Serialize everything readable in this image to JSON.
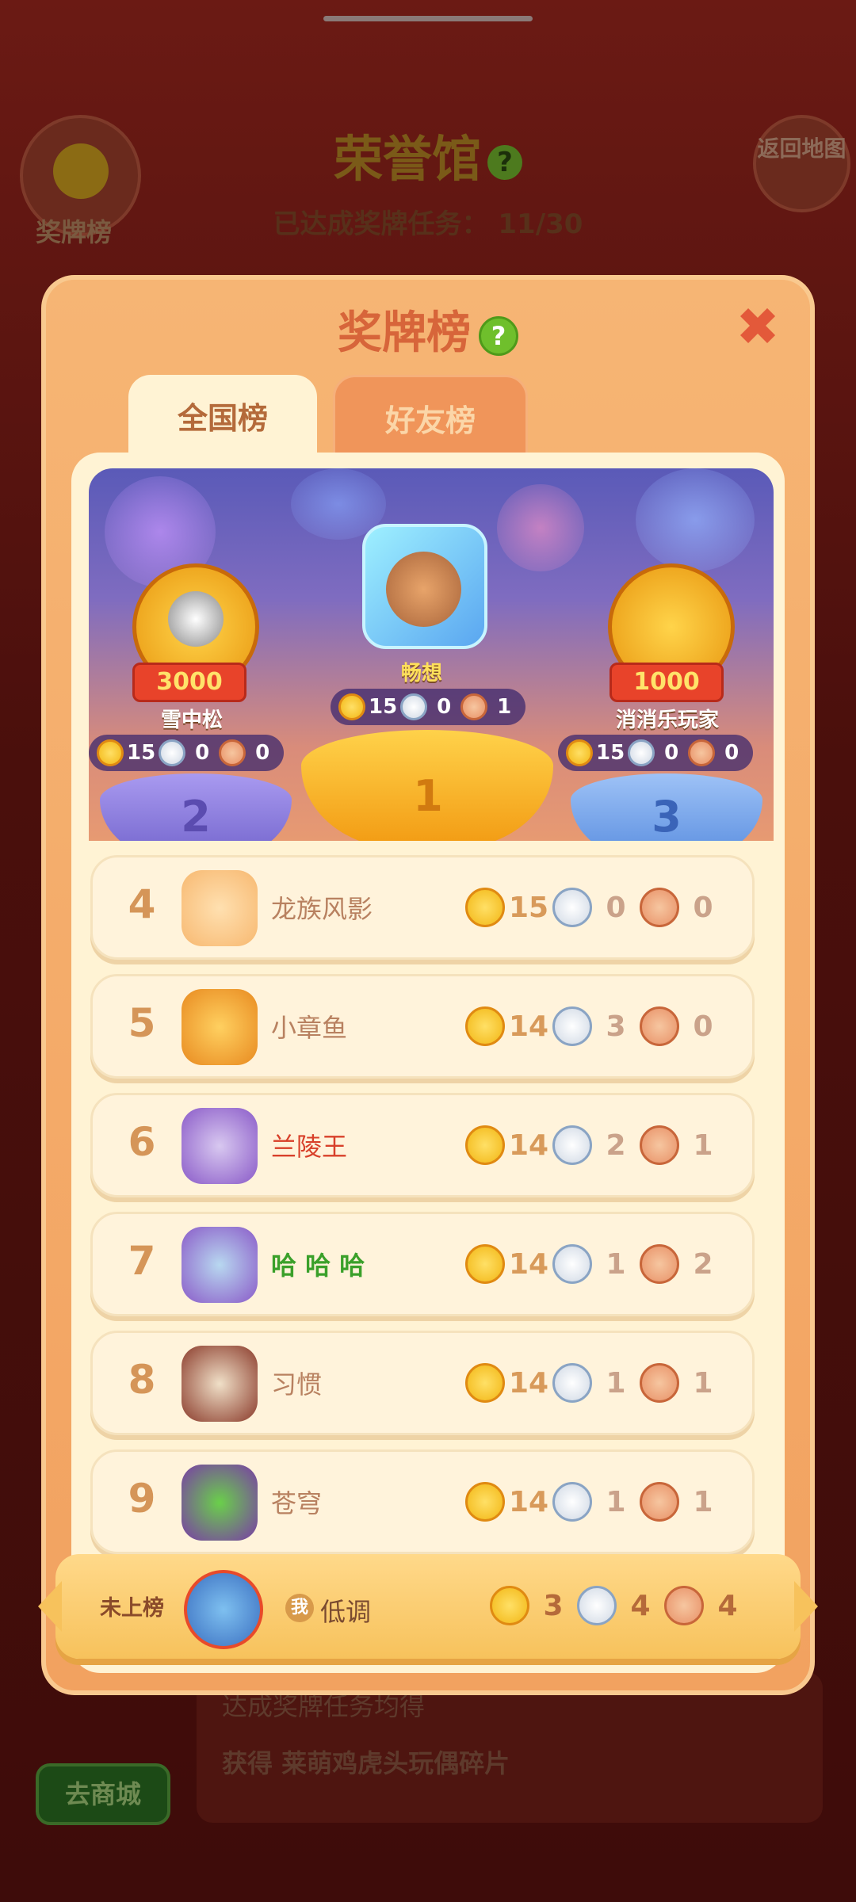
{
  "background": {
    "title": "荣誉馆",
    "progress": "已达成奖牌任务： 11/30",
    "medal_board_label": "奖牌榜",
    "return_map_label": "返回地图",
    "shop_button": "去商城",
    "desc_line1": "达成奖牌任务均得",
    "desc_line2": "获得 莱萌鸡虎头玩偶碎片"
  },
  "modal": {
    "title": "奖牌榜",
    "help_icon": "?",
    "close_icon": "✖",
    "tabs": [
      {
        "label": "全国榜",
        "active": true
      },
      {
        "label": "好友榜",
        "active": false
      }
    ]
  },
  "podium": [
    {
      "place": "1",
      "name": "畅想",
      "gold": "15",
      "silver": "0",
      "bronze": "1"
    },
    {
      "place": "2",
      "name": "雪中松",
      "score_badge": "3000",
      "gold": "15",
      "silver": "0",
      "bronze": "0"
    },
    {
      "place": "3",
      "name": "消消乐玩家",
      "score_badge": "1000",
      "gold": "15",
      "silver": "0",
      "bronze": "0"
    }
  ],
  "rankings": [
    {
      "rank": "4",
      "name": "龙族风影",
      "gold": "15",
      "silver": "0",
      "bronze": "0",
      "name_color": "#b88160"
    },
    {
      "rank": "5",
      "name": "小章鱼",
      "gold": "14",
      "silver": "3",
      "bronze": "0",
      "name_color": "#b88160"
    },
    {
      "rank": "6",
      "name": "兰陵王",
      "gold": "14",
      "silver": "2",
      "bronze": "1",
      "name_color": "#d8402a"
    },
    {
      "rank": "7",
      "name": "哈 哈 哈",
      "gold": "14",
      "silver": "1",
      "bronze": "2",
      "name_color": "#3aa02a"
    },
    {
      "rank": "8",
      "name": "习惯",
      "gold": "14",
      "silver": "1",
      "bronze": "1",
      "name_color": "#b88160"
    },
    {
      "rank": "9",
      "name": "苍穹",
      "gold": "14",
      "silver": "1",
      "bronze": "1",
      "name_color": "#b88160"
    }
  ],
  "my_entry": {
    "rank_label": "未上榜",
    "me_tag": "我",
    "name": "低调",
    "gold": "3",
    "silver": "4",
    "bronze": "4"
  },
  "colors": {
    "modal_orange": "#f2a260",
    "title_orange": "#d7653a",
    "board_cream": "#fff3d4",
    "help_green": "#6fbf2c"
  }
}
